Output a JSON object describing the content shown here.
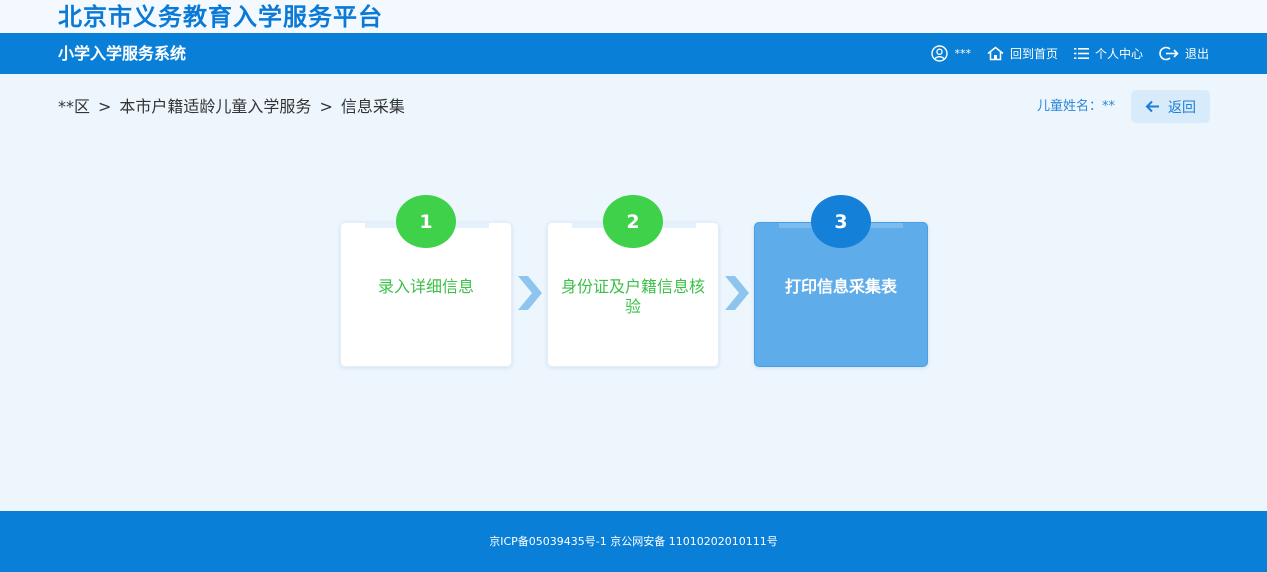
{
  "header": {
    "platform_title": "北京市义务教育入学服务平台",
    "system_title": "小学入学服务系统",
    "user_name": "***",
    "home_label": "回到首页",
    "profile_label": "个人中心",
    "logout_label": "退出"
  },
  "breadcrumb": {
    "district": "**区",
    "service": "本市户籍适龄儿童入学服务",
    "page": "信息采集",
    "separator": ">"
  },
  "child": {
    "label": "儿童姓名：",
    "name": "**"
  },
  "back_label": "返回",
  "steps": [
    {
      "number": "1",
      "label": "录入详细信息"
    },
    {
      "number": "2",
      "label": "身份证及户籍信息核验"
    },
    {
      "number": "3",
      "label": "打印信息采集表"
    }
  ],
  "footer": {
    "icp": "京ICP备05039435号-1 京公网安备 11010202010111号"
  },
  "colors": {
    "primary": "#0a7fd8",
    "completed_step": "#3fd14a",
    "active_step_card": "#5eace9",
    "active_step_number": "#1480d8",
    "background": "#eef6fd"
  }
}
